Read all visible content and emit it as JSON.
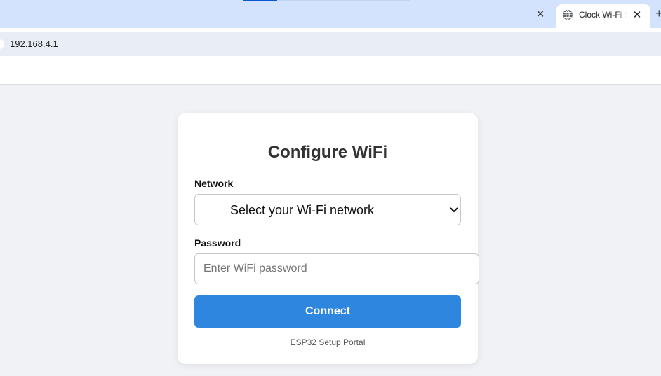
{
  "browser": {
    "active_tab": {
      "title": "Clock Wi-Fi Setup",
      "close_glyph": "✕",
      "favicon": "globe-icon"
    },
    "inactive_tab": {
      "close_glyph": "✕"
    },
    "new_tab_glyph": "+",
    "url": "192.168.4.1"
  },
  "page": {
    "title": "Configure WiFi",
    "network": {
      "label": "Network",
      "selected": "Select your Wi-Fi network"
    },
    "password": {
      "label": "Password",
      "placeholder": "Enter WiFi password",
      "value": ""
    },
    "connect_label": "Connect",
    "footer": "ESP32 Setup Portal"
  },
  "colors": {
    "tabstrip": "#d3e3fd",
    "page_background": "#f1f2f6",
    "button": "#2f86de",
    "accent": "#0b57d0"
  }
}
